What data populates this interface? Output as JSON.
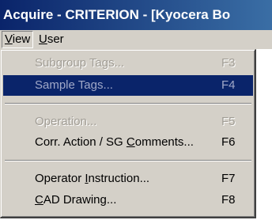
{
  "window": {
    "title": "Acquire - CRITERION - [Kyocera Bo"
  },
  "menubar": {
    "items": [
      {
        "label_prefix": "",
        "mnemonic": "V",
        "label_rest": "iew",
        "state": "open"
      },
      {
        "label_prefix": "",
        "mnemonic": "U",
        "label_rest": "ser",
        "state": "closed"
      }
    ]
  },
  "view_menu": {
    "items": [
      {
        "label": "Subgroup Tags...",
        "shortcut": "F3",
        "enabled": false,
        "highlighted": false
      },
      {
        "label": "Sample Tags...",
        "shortcut": "F4",
        "enabled": false,
        "highlighted": true
      },
      {
        "label": "Operation...",
        "shortcut": "F5",
        "enabled": false,
        "highlighted": false
      },
      {
        "label_prefix": "Corr. Action / SG ",
        "mnemonic": "C",
        "label_rest": "omments...",
        "shortcut": "F6",
        "enabled": true,
        "highlighted": false
      },
      {
        "label_prefix": "Operator ",
        "mnemonic": "I",
        "label_rest": "nstruction...",
        "shortcut": "F7",
        "enabled": true,
        "highlighted": false
      },
      {
        "label_prefix": "",
        "mnemonic": "C",
        "label_rest": "AD Drawing...",
        "shortcut": "F8",
        "enabled": true,
        "highlighted": false
      }
    ]
  },
  "colors": {
    "menu_face": "#d4d0c8",
    "highlight": "#0a246a",
    "disabled_text": "#a09c94",
    "title_gradient_start": "#0a246a",
    "title_gradient_end": "#3a6ea5"
  }
}
